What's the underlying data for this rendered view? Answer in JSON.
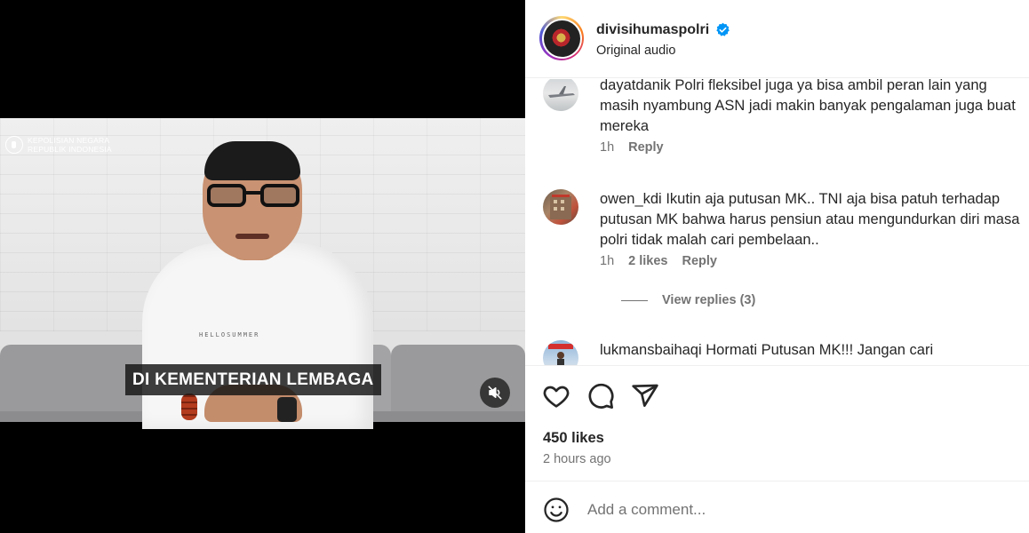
{
  "video": {
    "watermark_line1": "KEPOLISIAN NEGARA",
    "watermark_line2": "REPUBLIK INDONESIA",
    "caption": "DI KEMENTERIAN LEMBAGA",
    "shirt_text": "HELLOSUMMER",
    "mute_icon": "speaker-muted-icon"
  },
  "post": {
    "username": "divisihumaspolri",
    "verified_icon": "verified-badge-icon",
    "subtitle": "Original audio",
    "brand_color": "#0095f6"
  },
  "comments": [
    {
      "user": "dayatdanik",
      "text": "Polri fleksibel juga ya bisa ambil peran lain yang masih nyambung ASN jadi makin banyak pengalaman juga buat mereka",
      "time": "1h",
      "reply": "Reply"
    },
    {
      "user": "owen_kdi",
      "text": "Ikutin aja putusan MK.. TNI aja bisa patuh terhadap putusan MK bahwa harus pensiun atau mengundurkan diri masa polri tidak malah cari pembelaan..",
      "time": "1h",
      "likes": "2 likes",
      "reply": "Reply",
      "view_replies": "View replies (3)"
    },
    {
      "user": "lukmansbaihaqi",
      "text": "Hormati Putusan MK!!! Jangan cari"
    }
  ],
  "actions": {
    "icons": [
      "heart-icon",
      "comment-icon",
      "share-icon"
    ],
    "likes": "450 likes",
    "time": "2 hours ago"
  },
  "add_comment": {
    "emoji_icon": "emoji-icon",
    "placeholder": "Add a comment..."
  }
}
